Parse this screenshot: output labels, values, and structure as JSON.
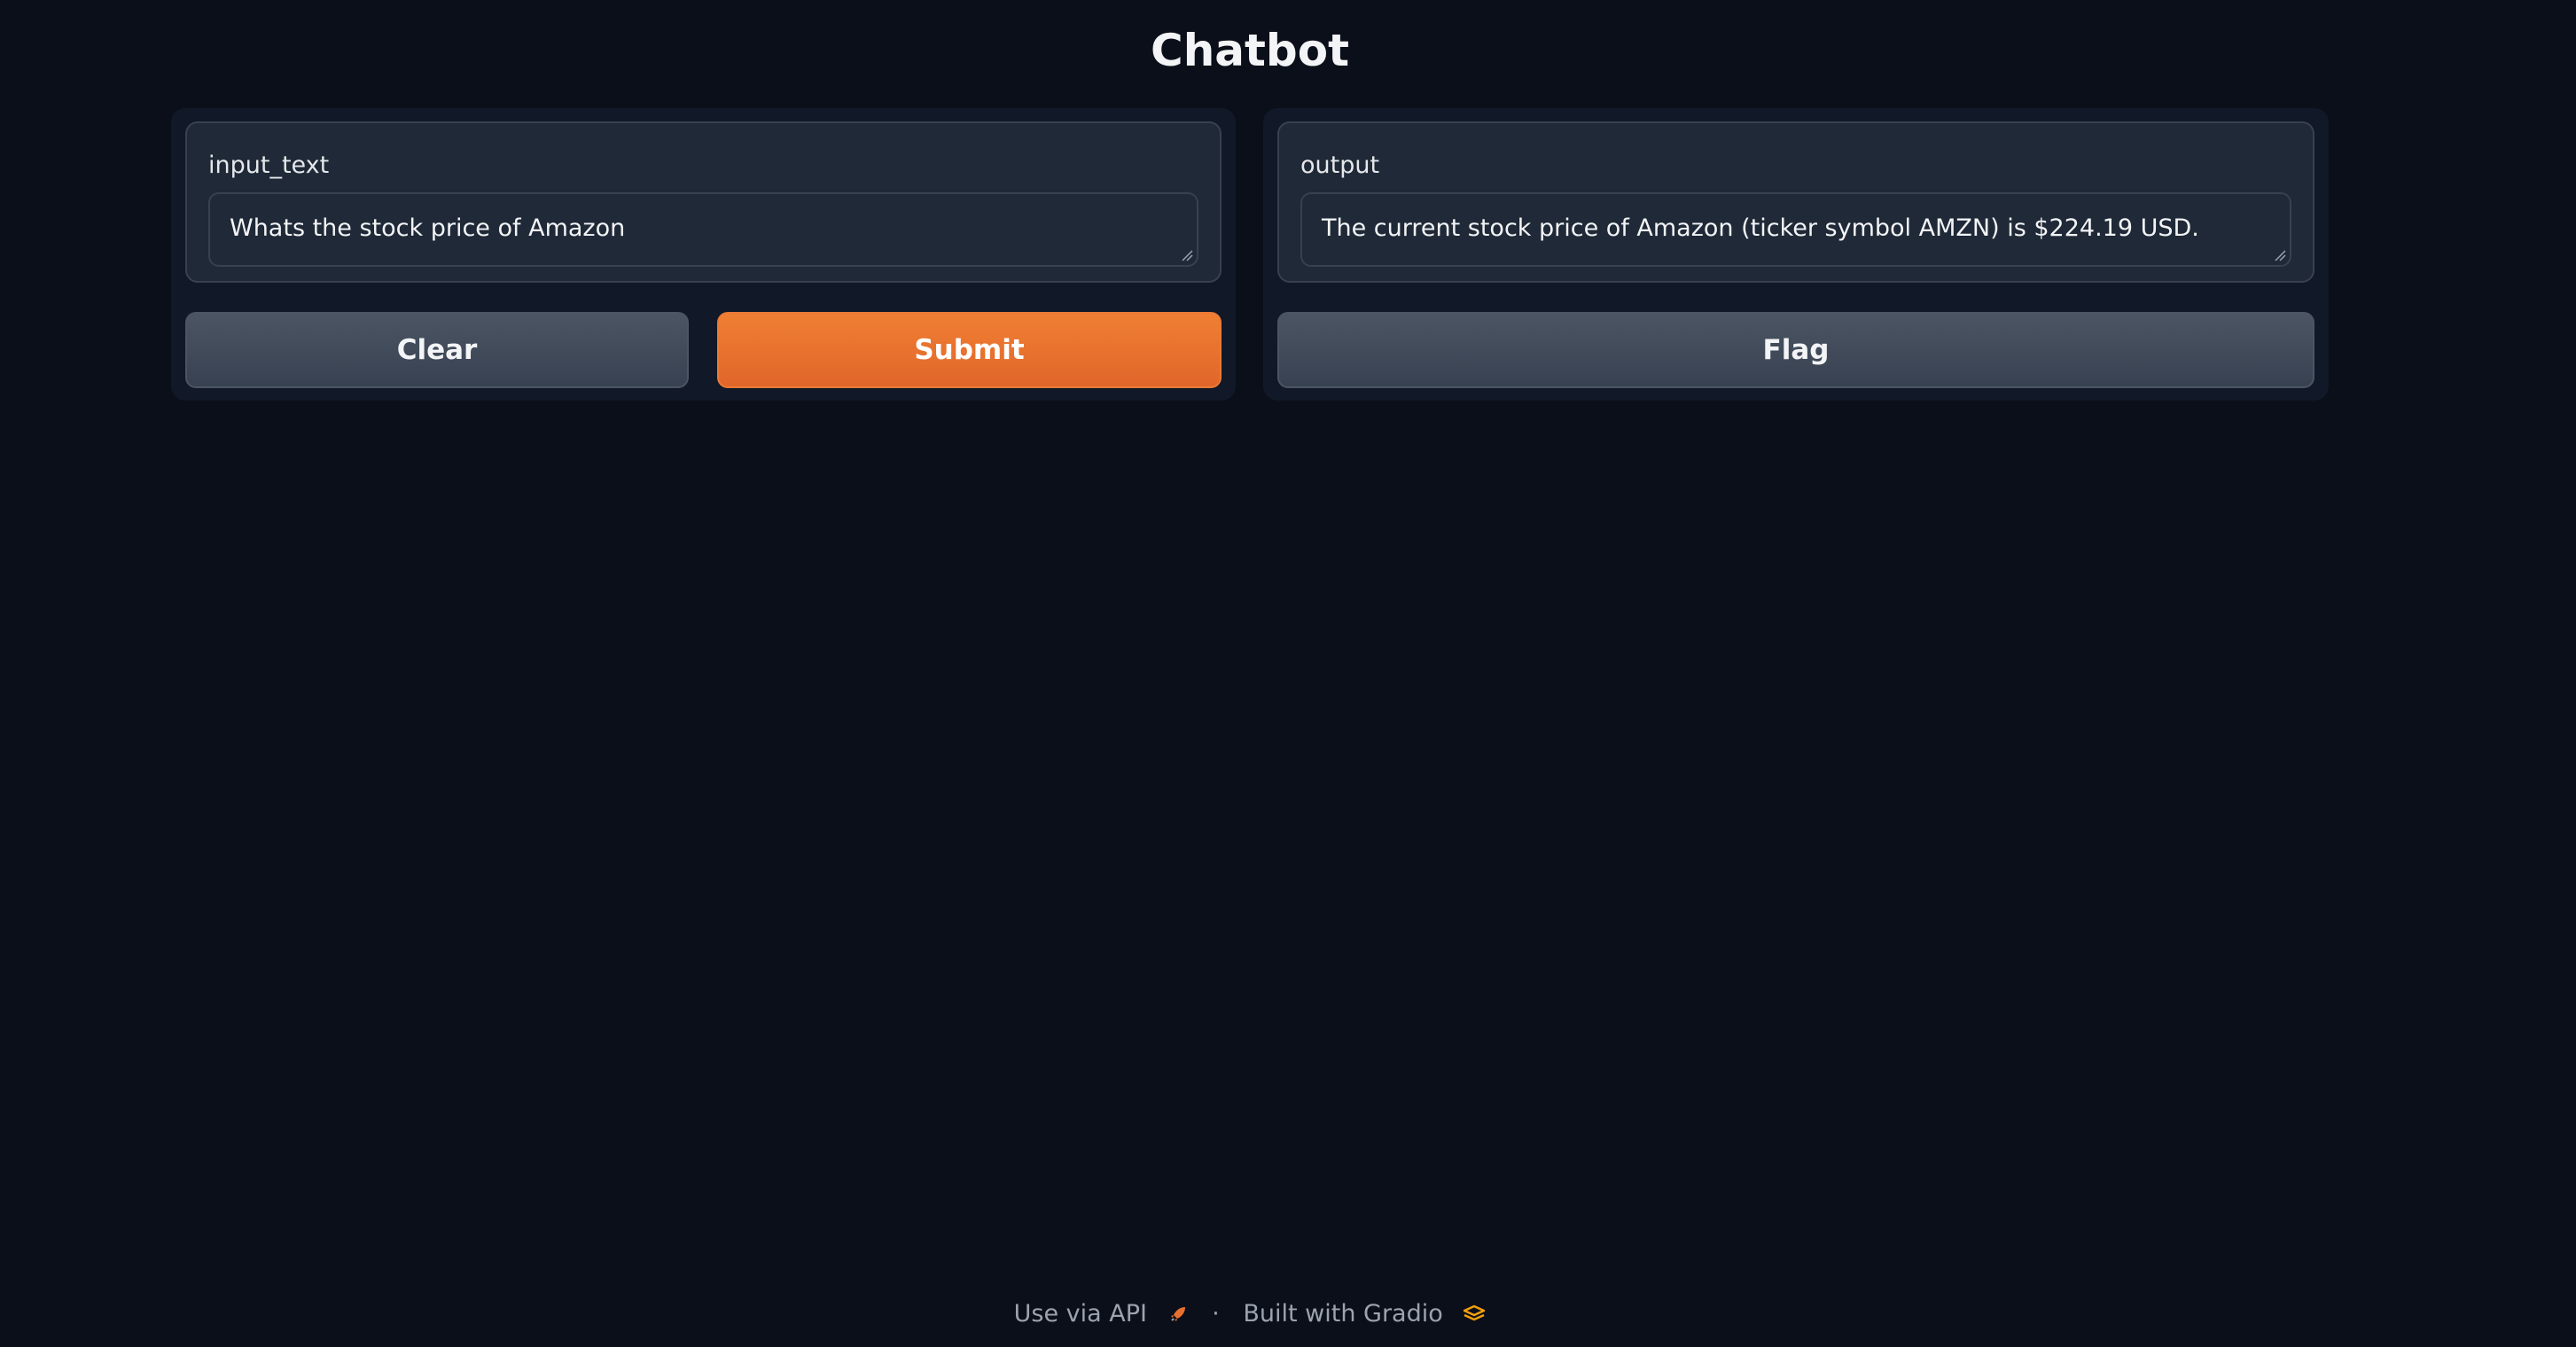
{
  "app": {
    "title": "Chatbot"
  },
  "input_panel": {
    "label": "input_text",
    "value": "Whats the stock price of Amazon",
    "clear_label": "Clear",
    "submit_label": "Submit"
  },
  "output_panel": {
    "label": "output",
    "value": "The current stock price of Amazon (ticker symbol AMZN) is $224.19 USD.",
    "flag_label": "Flag"
  },
  "footer": {
    "api_link": "Use via API",
    "separator": "·",
    "built_with": "Built with Gradio",
    "api_icon": "rocket-icon",
    "gradio_icon": "gradio-logo-icon"
  },
  "colors": {
    "background": "#0b0f19",
    "panel": "#111827",
    "field": "#1f2937",
    "border": "#374151",
    "primary": "#e8702e",
    "secondary": "#4b5563"
  }
}
